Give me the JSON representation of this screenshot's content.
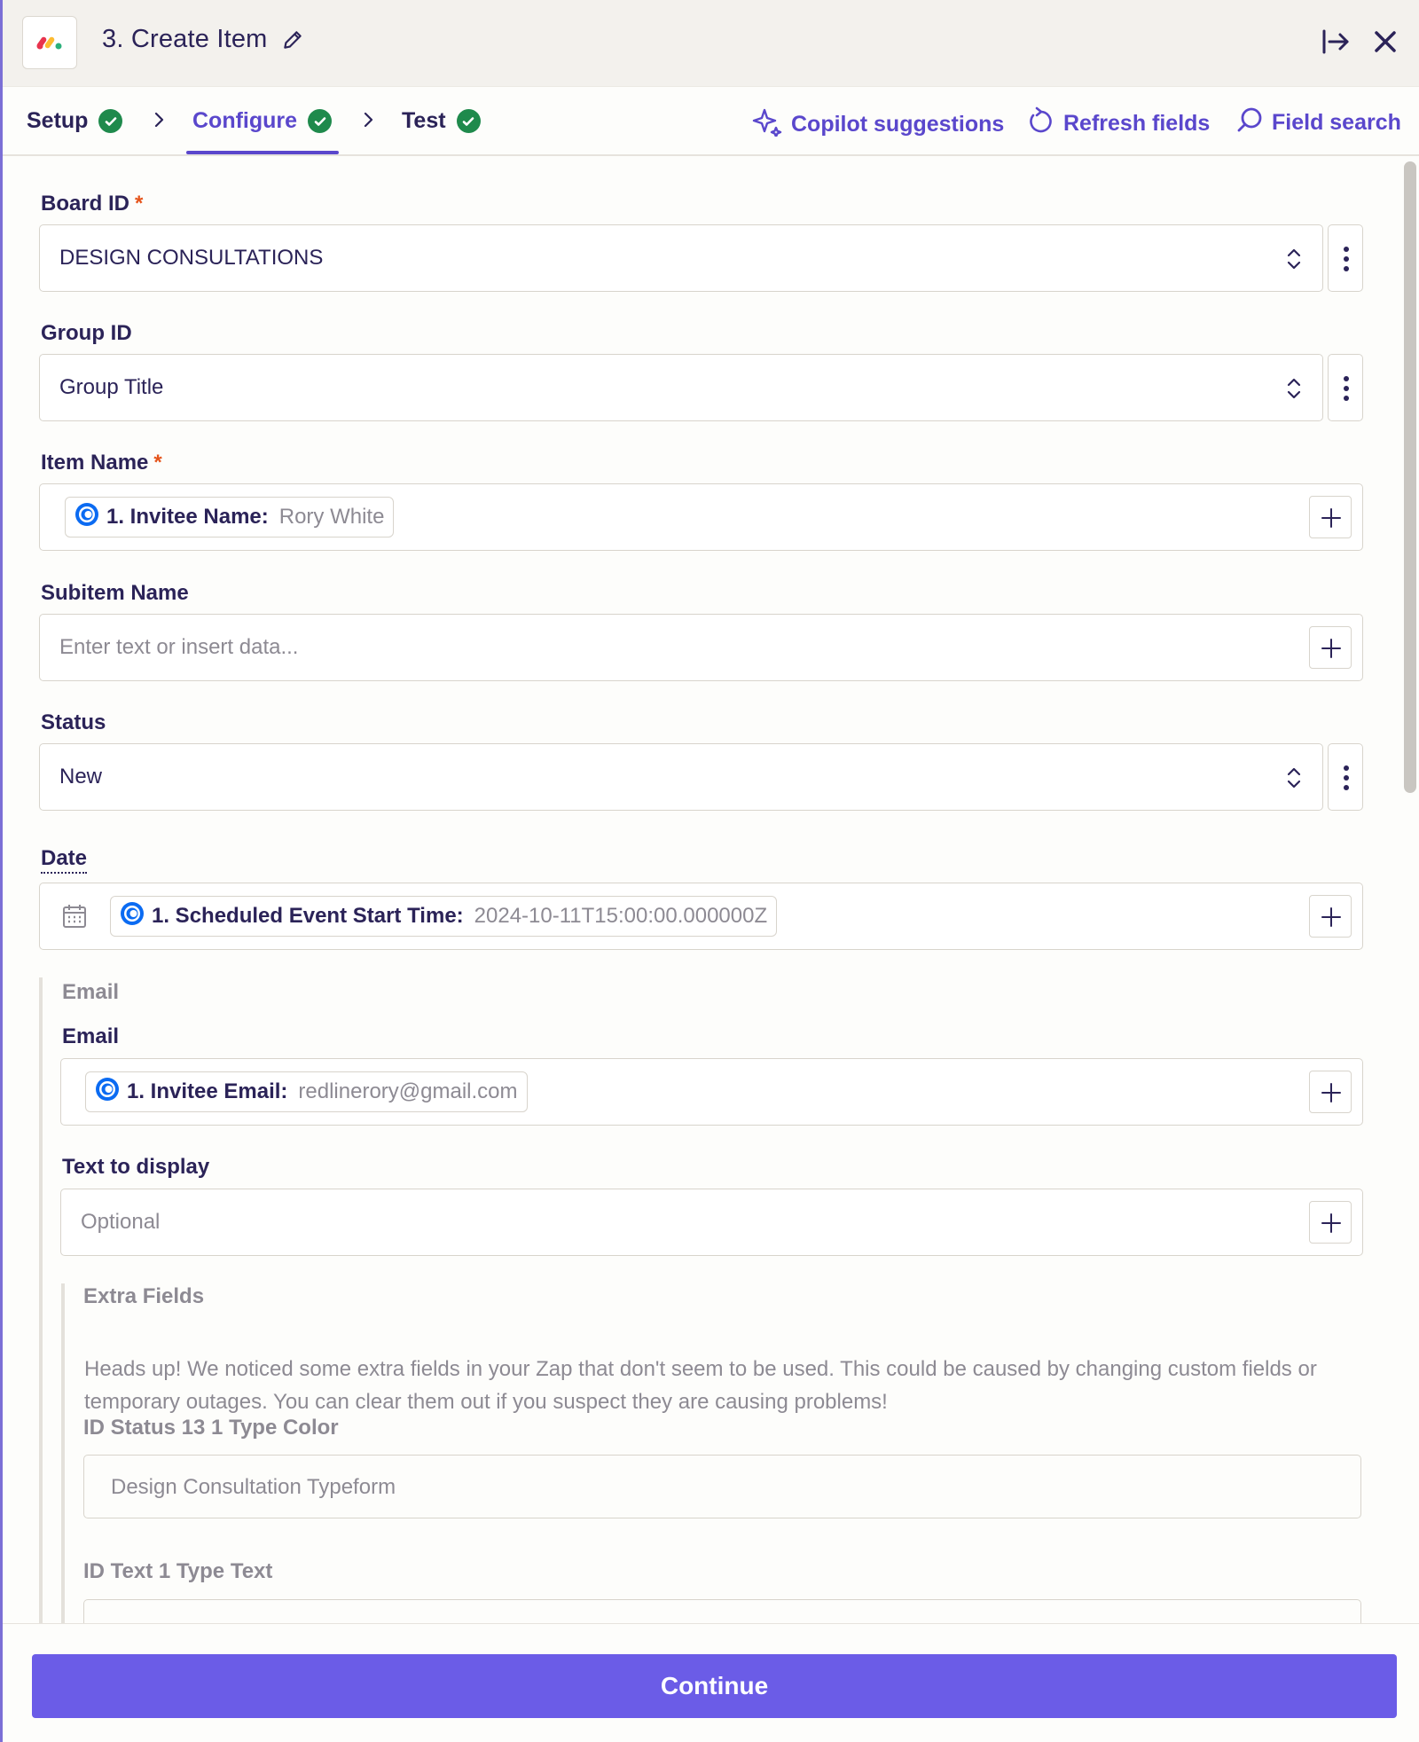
{
  "header": {
    "title": "3. Create Item"
  },
  "tabs": [
    {
      "label": "Setup",
      "complete": true
    },
    {
      "label": "Configure",
      "complete": true,
      "active": true
    },
    {
      "label": "Test",
      "complete": true
    }
  ],
  "actions": {
    "copilot": "Copilot suggestions",
    "refresh": "Refresh fields",
    "search": "Field search"
  },
  "fields": {
    "board_id": {
      "label": "Board ID",
      "required": "*",
      "value": "DESIGN CONSULTATIONS"
    },
    "group_id": {
      "label": "Group ID",
      "value": "Group Title"
    },
    "item_name": {
      "label": "Item Name",
      "required": "*",
      "pill_key": "1. Invitee Name:",
      "pill_value": "Rory White"
    },
    "subitem_name": {
      "label": "Subitem Name",
      "placeholder": "Enter text or insert data..."
    },
    "status": {
      "label": "Status",
      "value": "New"
    },
    "date": {
      "label": "Date",
      "pill_key": "1. Scheduled Event Start Time:",
      "pill_value": "2024-10-11T15:00:00.000000Z"
    }
  },
  "email_group": {
    "title": "Email",
    "email": {
      "label": "Email",
      "pill_key": "1. Invitee Email:",
      "pill_value": "redlinerory@gmail.com"
    },
    "text_to_display": {
      "label": "Text to display",
      "placeholder": "Optional"
    }
  },
  "extra_fields": {
    "title": "Extra Fields",
    "note": "Heads up! We noticed some extra fields in your Zap that don't seem to be used. This could be caused by changing custom fields or temporary outages. You can clear them out if you suspect they are causing problems!",
    "field1": {
      "label": "ID Status 13 1 Type Color",
      "value": "Design Consultation Typeform"
    },
    "field2": {
      "label": "ID Text 1 Type Text"
    }
  },
  "footer": {
    "continue_label": "Continue"
  },
  "colors": {
    "accent": "#5a47cc",
    "button": "#6b5ce7",
    "check": "#1f8a4c",
    "required": "#e5541b"
  }
}
